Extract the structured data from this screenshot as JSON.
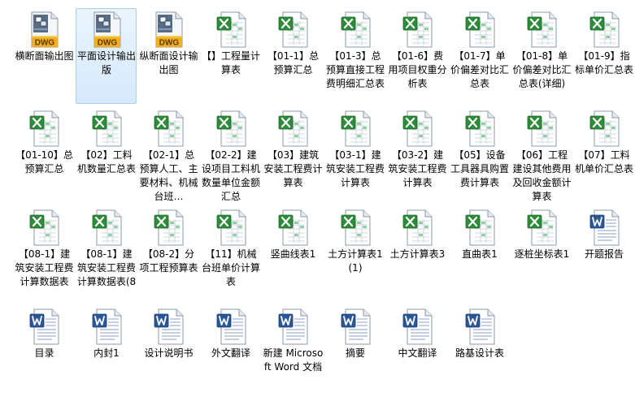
{
  "files": [
    {
      "name": "横断面输出图",
      "type": "dwg",
      "badge": "DWG",
      "selected": false
    },
    {
      "name": "平面设计输出版",
      "type": "dwg",
      "badge": "DWG",
      "selected": true
    },
    {
      "name": "纵断面设计输出图",
      "type": "dwg",
      "badge": "DWG",
      "selected": false
    },
    {
      "name": "【】工程量计算表",
      "type": "excel",
      "selected": false
    },
    {
      "name": "【01-1】总预算汇总",
      "type": "excel",
      "selected": false
    },
    {
      "name": "【01-3】总预算直接工程费明细汇总表",
      "type": "excel",
      "selected": false
    },
    {
      "name": "【01-6】费用项目权重分析表",
      "type": "excel",
      "selected": false
    },
    {
      "name": "【01-7】单价偏差对比汇总表",
      "type": "excel",
      "selected": false
    },
    {
      "name": "【01-8】单价偏差对比汇总表(详细)",
      "type": "excel",
      "selected": false
    },
    {
      "name": "【01-9】指标单价汇总表",
      "type": "excel",
      "selected": false
    },
    {
      "name": "【01-10】总预算汇总",
      "type": "excel",
      "selected": false
    },
    {
      "name": "【02】工料机数量汇总表",
      "type": "excel",
      "selected": false
    },
    {
      "name": "【02-1】总预算人工、主要材料、机械台班…",
      "type": "excel",
      "selected": false
    },
    {
      "name": "【02-2】建设项目工料机数量单位金额汇总",
      "type": "excel",
      "selected": false
    },
    {
      "name": "【03】建筑安装工程费计算表",
      "type": "excel",
      "selected": false
    },
    {
      "name": "【03-1】建筑安装工程费计算表",
      "type": "excel",
      "selected": false
    },
    {
      "name": "【03-2】建筑安装工程费计算表",
      "type": "excel",
      "selected": false
    },
    {
      "name": "【05】设备工具器具购置费计算表",
      "type": "excel",
      "selected": false
    },
    {
      "name": "【06】工程建设其他费用及回收金额计算表",
      "type": "excel",
      "selected": false
    },
    {
      "name": "【07】工料机单价汇总表",
      "type": "excel",
      "selected": false
    },
    {
      "name": "【08-1】建筑安装工程费计算数据表",
      "type": "excel",
      "selected": false
    },
    {
      "name": "【08-1】建筑安装工程费计算数据表(8",
      "type": "excel",
      "selected": false
    },
    {
      "name": "【08-2】分项工程预算表",
      "type": "excel",
      "selected": false
    },
    {
      "name": "【11】机械台班单价计算表",
      "type": "excel",
      "selected": false
    },
    {
      "name": "竖曲线表1",
      "type": "excel",
      "selected": false
    },
    {
      "name": "土方计算表1 (1)",
      "type": "excel",
      "selected": false
    },
    {
      "name": "土方计算表3",
      "type": "excel",
      "selected": false
    },
    {
      "name": "直曲表1",
      "type": "excel",
      "selected": false
    },
    {
      "name": "逐桩坐标表1",
      "type": "excel",
      "selected": false
    },
    {
      "name": "开题报告",
      "type": "word",
      "selected": false
    },
    {
      "name": "目录",
      "type": "word",
      "selected": false
    },
    {
      "name": "内封1",
      "type": "word",
      "selected": false
    },
    {
      "name": "设计说明书",
      "type": "word",
      "selected": false
    },
    {
      "name": "外文翻译",
      "type": "word",
      "selected": false
    },
    {
      "name": "新建 Microsoft Word 文档",
      "type": "word",
      "selected": false
    },
    {
      "name": "摘要",
      "type": "word",
      "selected": false
    },
    {
      "name": "中文翻译",
      "type": "word",
      "selected": false
    },
    {
      "name": "路基设计表",
      "type": "word",
      "selected": false
    }
  ],
  "icons": {
    "dwg": "dwg-file-icon",
    "excel": "excel-file-icon",
    "word": "word-file-icon"
  },
  "colors": {
    "selection_fill": "#d6e9fb",
    "selection_border": "#a9cff2",
    "dwg_badge": "#f2b01e",
    "excel_green": "#2e8b3a",
    "word_blue": "#2b5797"
  }
}
